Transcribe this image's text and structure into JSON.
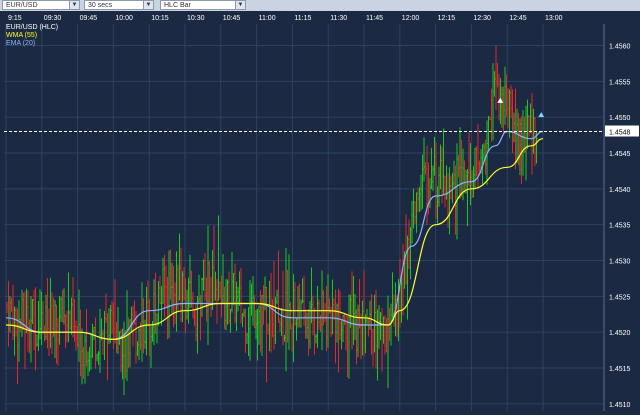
{
  "toolbar": {
    "symbol": "EUR/USD",
    "interval": "30 secs",
    "chart_type": "HLC Bar"
  },
  "legend": [
    {
      "label": "EUR/USD (HLC)",
      "color": "#ffffff"
    },
    {
      "label": "WMA (55)",
      "color": "#ffff33"
    },
    {
      "label": "EMA (20)",
      "color": "#8fb3ff"
    }
  ],
  "current_price": "1.4548",
  "colors": {
    "background": "#1b2a42",
    "grid": "#2f4263",
    "up_bar": "#21c521",
    "down_bar": "#e02b2b",
    "wma": "#ffff33",
    "ema": "#8fb3ff",
    "price_line": "#ffffff"
  },
  "chart_data": {
    "type": "bar",
    "title": "",
    "x_tick_labels": [
      "9:15",
      "09:30",
      "09:45",
      "10:00",
      "10:15",
      "10:30",
      "10:45",
      "11:00",
      "11:15",
      "11:30",
      "11:45",
      "12:00",
      "12:15",
      "12:30",
      "12:45",
      "13:00"
    ],
    "y_tick_labels": [
      "1.4560",
      "1.4555",
      "1.4550",
      "1.4545",
      "1.4540",
      "1.4535",
      "1.4530",
      "1.4525",
      "1.4520",
      "1.4515",
      "1.4510"
    ],
    "ylim": [
      1.4509,
      1.4563
    ],
    "price_path": [
      [
        "09:15",
        1.4524
      ],
      [
        "09:20",
        1.4521
      ],
      [
        "09:25",
        1.4522
      ],
      [
        "09:30",
        1.4521
      ],
      [
        "09:35",
        1.452
      ],
      [
        "09:40",
        1.4523
      ],
      [
        "09:45",
        1.4518
      ],
      [
        "09:50",
        1.4519
      ],
      [
        "09:55",
        1.452
      ],
      [
        "10:00",
        1.452
      ],
      [
        "10:05",
        1.4518
      ],
      [
        "10:10",
        1.452
      ],
      [
        "10:15",
        1.4522
      ],
      [
        "10:20",
        1.4525
      ],
      [
        "10:25",
        1.4528
      ],
      [
        "10:30",
        1.4524
      ],
      [
        "10:35",
        1.4523
      ],
      [
        "10:40",
        1.4527
      ],
      [
        "10:45",
        1.4523
      ],
      [
        "10:50",
        1.4525
      ],
      [
        "10:55",
        1.4522
      ],
      [
        "11:00",
        1.4524
      ],
      [
        "11:05",
        1.4523
      ],
      [
        "11:10",
        1.4522
      ],
      [
        "11:15",
        1.4523
      ],
      [
        "11:20",
        1.4521
      ],
      [
        "11:25",
        1.4522
      ],
      [
        "11:30",
        1.4522
      ],
      [
        "11:35",
        1.4523
      ],
      [
        "11:40",
        1.4521
      ],
      [
        "11:45",
        1.4521
      ],
      [
        "11:50",
        1.452
      ],
      [
        "11:55",
        1.452
      ],
      [
        "12:00",
        1.4524
      ],
      [
        "12:05",
        1.4536
      ],
      [
        "12:10",
        1.4541
      ],
      [
        "12:15",
        1.4541
      ],
      [
        "12:20",
        1.454
      ],
      [
        "12:25",
        1.4541
      ],
      [
        "12:30",
        1.4541
      ],
      [
        "12:35",
        1.4545
      ],
      [
        "12:40",
        1.4553
      ],
      [
        "12:45",
        1.4551
      ],
      [
        "12:50",
        1.4547
      ],
      [
        "12:55",
        1.4548
      ],
      [
        "13:00",
        1.4549
      ]
    ],
    "wma_path": [
      [
        "09:15",
        1.4521
      ],
      [
        "09:30",
        1.452
      ],
      [
        "09:45",
        1.452
      ],
      [
        "10:00",
        1.4519
      ],
      [
        "10:15",
        1.4521
      ],
      [
        "10:30",
        1.4523
      ],
      [
        "10:45",
        1.4524
      ],
      [
        "11:00",
        1.4524
      ],
      [
        "11:15",
        1.4523
      ],
      [
        "11:30",
        1.4523
      ],
      [
        "11:45",
        1.4522
      ],
      [
        "11:55",
        1.4521
      ],
      [
        "12:00",
        1.4523
      ],
      [
        "12:15",
        1.4535
      ],
      [
        "12:30",
        1.454
      ],
      [
        "12:45",
        1.4543
      ],
      [
        "12:55",
        1.4546
      ],
      [
        "13:00",
        1.4547
      ]
    ],
    "ema_path": [
      [
        "09:15",
        1.4522
      ],
      [
        "09:30",
        1.452
      ],
      [
        "09:45",
        1.452
      ],
      [
        "10:00",
        1.4519
      ],
      [
        "10:15",
        1.4523
      ],
      [
        "10:30",
        1.4524
      ],
      [
        "10:45",
        1.4524
      ],
      [
        "11:00",
        1.4524
      ],
      [
        "11:15",
        1.4522
      ],
      [
        "11:30",
        1.4522
      ],
      [
        "11:45",
        1.4521
      ],
      [
        "11:55",
        1.4521
      ],
      [
        "12:05",
        1.4532
      ],
      [
        "12:15",
        1.4539
      ],
      [
        "12:30",
        1.4541
      ],
      [
        "12:40",
        1.4546
      ],
      [
        "12:45",
        1.4548
      ],
      [
        "12:55",
        1.4547
      ],
      [
        "13:00",
        1.4548
      ]
    ],
    "xlabel": "",
    "ylabel": ""
  }
}
